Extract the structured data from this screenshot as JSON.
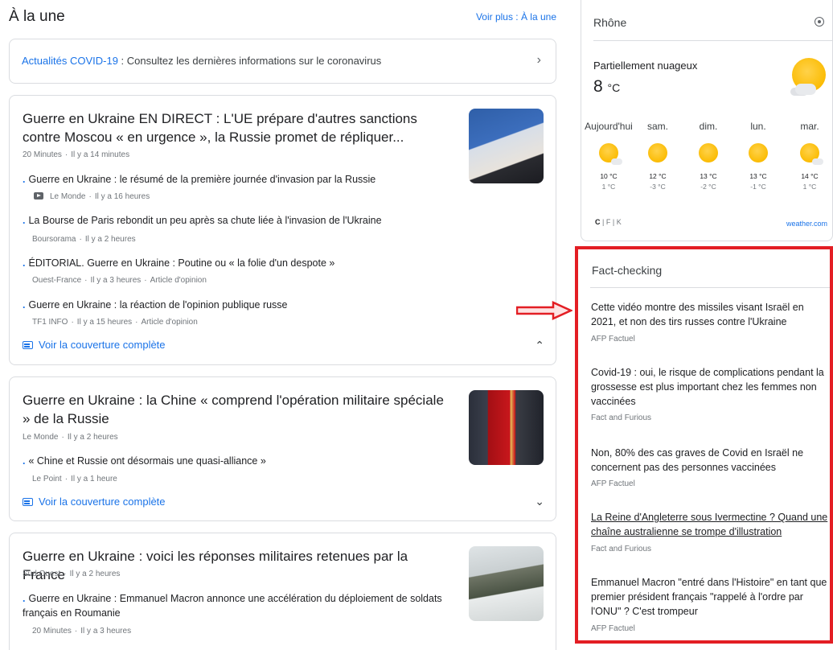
{
  "top_stories": {
    "title": "À la une",
    "more_link": "Voir plus : À la une"
  },
  "covid_banner": {
    "link": "Actualités COVID-19",
    "text": " : Consultez les dernières informations sur le coronavirus"
  },
  "stories": [
    {
      "title": "Guerre en Ukraine EN DIRECT : L'UE prépare d'autres sanctions contre Moscou « en urgence », la Russie promet de répliquer...",
      "source": "20 Minutes",
      "time": "Il y a 14 minutes",
      "subs": [
        {
          "text": "Guerre en Ukraine : le résumé de la première journée d'invasion par la Russie",
          "source": "Le Monde",
          "time": "Il y a 16 heures",
          "tag": ""
        },
        {
          "text": "La Bourse de Paris rebondit un peu après sa chute liée à l'invasion de l'Ukraine",
          "source": "Boursorama",
          "time": "Il y a 2 heures",
          "tag": ""
        },
        {
          "text": "ÉDITORIAL. Guerre en Ukraine : Poutine ou « la folie d'un despote »",
          "source": "Ouest-France",
          "time": "Il y a 3 heures",
          "tag": "Article d'opinion"
        },
        {
          "text": "Guerre en Ukraine : la réaction de l'opinion publique russe",
          "source": "TF1 INFO",
          "time": "Il y a 15 heures",
          "tag": "Article d'opinion"
        }
      ],
      "coverage": "Voir la couverture complète"
    },
    {
      "title": "Guerre en Ukraine : la Chine « comprend l'opération militaire spéciale » de la Russie",
      "source": "Le Monde",
      "time": "Il y a 2 heures",
      "subs": [
        {
          "text": "« Chine et Russie ont désormais une quasi-alliance »",
          "source": "Le Point",
          "time": "Il y a 1 heure",
          "tag": ""
        }
      ],
      "coverage": "Voir la couverture complète"
    },
    {
      "title": "Guerre en Ukraine : voici les réponses militaires retenues par la France",
      "source": "Sud Ouest",
      "time": "Il y a 2 heures",
      "subs": [
        {
          "text": "Guerre en Ukraine : Emmanuel Macron annonce une accélération du déploiement de soldats français en Roumanie",
          "source": "20 Minutes",
          "time": "Il y a 3 heures",
          "tag": ""
        }
      ]
    }
  ],
  "weather": {
    "location": "Rhône",
    "condition": "Partiellement nuageux",
    "temp": "8",
    "unit": "°C",
    "days": [
      {
        "name": "Aujourd'hui",
        "hi": "10 °C",
        "lo": "1 °C",
        "icon": "partly-cloudy"
      },
      {
        "name": "sam.",
        "hi": "12 °C",
        "lo": "-3 °C",
        "icon": "sunny"
      },
      {
        "name": "dim.",
        "hi": "13 °C",
        "lo": "-2 °C",
        "icon": "sunny"
      },
      {
        "name": "lun.",
        "hi": "13 °C",
        "lo": "-1 °C",
        "icon": "sunny"
      },
      {
        "name": "mar.",
        "hi": "14 °C",
        "lo": "1 °C",
        "icon": "partly-cloudy"
      }
    ],
    "units": [
      "C",
      "F",
      "K"
    ],
    "source": "weather.com"
  },
  "fact_checking": {
    "title": "Fact-checking",
    "items": [
      {
        "text": "Cette vidéo montre des missiles visant Israël en 2021, et non des tirs russes contre l'Ukraine",
        "source": "AFP Factuel"
      },
      {
        "text": "Covid-19 : oui, le risque de complications pendant la grossesse est plus important chez les femmes non vaccinées",
        "source": "Fact and Furious"
      },
      {
        "text": "Non, 80% des cas graves de Covid en Israël ne concernent pas des personnes vaccinées",
        "source": "AFP Factuel"
      },
      {
        "text": "La Reine d'Angleterre sous Ivermectine ? Quand une chaîne australienne se trompe d'illustration",
        "source": "Fact and Furious"
      },
      {
        "text": "Emmanuel Macron \"entré dans l'Histoire\" en tant que premier président français \"rappelé à l'ordre par l'ONU\" ? C'est trompeur",
        "source": "AFP Factuel"
      }
    ]
  },
  "colors": {
    "accent": "#1a73e8",
    "highlight": "#e31e24",
    "sun": "#fbbc04"
  },
  "icons": [
    "chevron-right-icon",
    "chevron-up-icon",
    "chevron-down-icon",
    "coverage-icon",
    "video-icon",
    "location-icon",
    "sun-icon",
    "arrow-icon"
  ]
}
